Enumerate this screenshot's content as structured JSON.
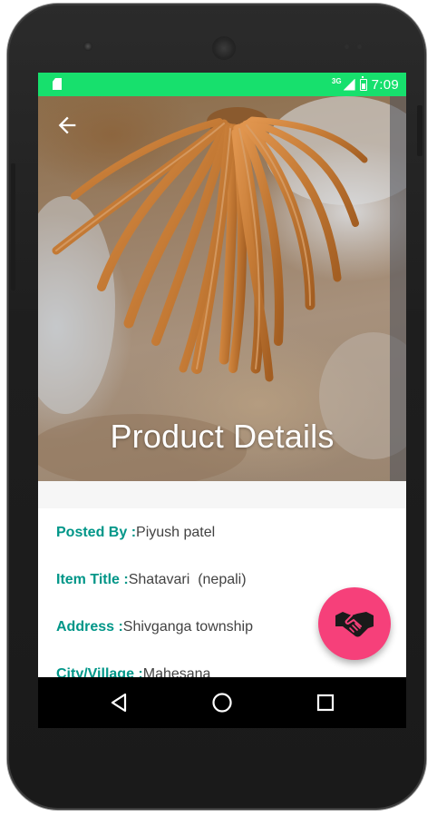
{
  "status_bar": {
    "network": "3G",
    "time": "7:09",
    "background": "#17e06d"
  },
  "toolbar": {
    "back_icon": "arrow-back-icon",
    "title": "Product Details"
  },
  "details": {
    "posted_by_label": "Posted By :",
    "posted_by_value": "Piyush patel",
    "item_title_label": "Item Title :",
    "item_title_value": "Shatavari  (nepali)",
    "address_label": "Address :",
    "address_value": "Shivganga township",
    "city_label": "City/Village :",
    "city_value": "Mahesana",
    "label_color": "#009688"
  },
  "fab": {
    "icon": "handshake-icon",
    "color": "#f6407a"
  },
  "nav_bar": {
    "back": "nav-back-icon",
    "home": "nav-home-icon",
    "recents": "nav-recents-icon"
  }
}
